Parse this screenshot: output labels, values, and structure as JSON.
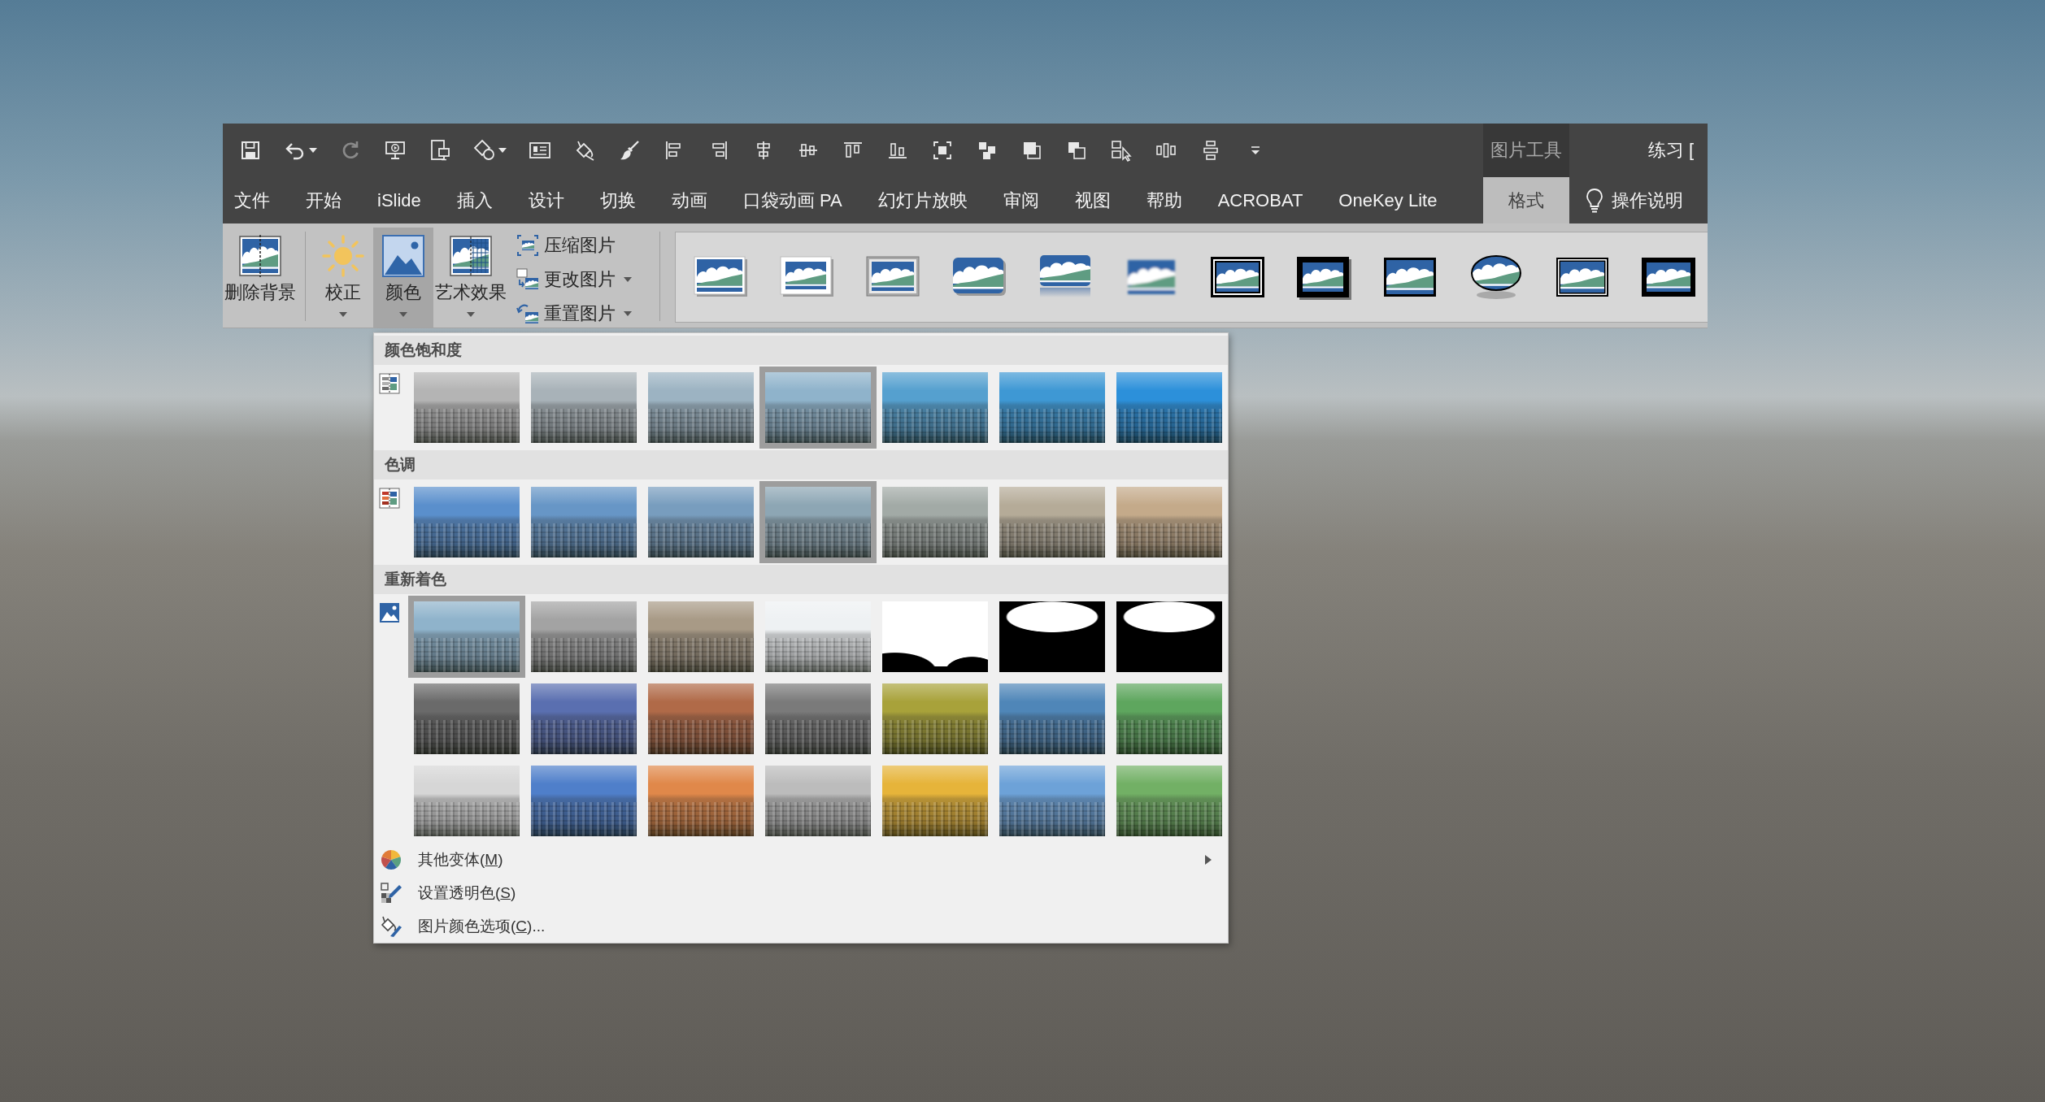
{
  "quick_access": [
    {
      "disabled": false
    },
    {
      "disabled": false
    },
    {
      "disabled": true
    },
    {
      "disabled": false
    },
    {
      "disabled": false
    },
    {
      "disabled": false
    },
    {
      "disabled": false
    },
    {
      "disabled": false
    },
    {
      "disabled": false
    },
    {
      "disabled": false
    },
    {
      "disabled": false
    },
    {
      "disabled": false
    },
    {
      "disabled": false
    },
    {
      "disabled": false
    },
    {
      "disabled": false
    },
    {
      "disabled": false
    },
    {
      "disabled": false
    },
    {
      "disabled": false
    },
    {
      "disabled": false
    },
    {
      "disabled": false
    },
    {
      "disabled": false
    },
    {
      "disabled": false
    },
    {
      "disabled": false
    }
  ],
  "window": {
    "title": "练习 ["
  },
  "tabs": [
    {
      "label": "文件",
      "selected": false
    },
    {
      "label": "开始",
      "selected": false
    },
    {
      "label": "iSlide",
      "selected": false
    },
    {
      "label": "插入",
      "selected": false
    },
    {
      "label": "设计",
      "selected": false
    },
    {
      "label": "切换",
      "selected": false
    },
    {
      "label": "动画",
      "selected": false
    },
    {
      "label": "口袋动画 PA",
      "selected": false
    },
    {
      "label": "幻灯片放映",
      "selected": false
    },
    {
      "label": "审阅",
      "selected": false
    },
    {
      "label": "视图",
      "selected": false
    },
    {
      "label": "帮助",
      "selected": false
    },
    {
      "label": "ACROBAT",
      "selected": false
    },
    {
      "label": "OneKey Lite",
      "selected": false
    }
  ],
  "context_group": {
    "title": "图片工具",
    "tabs": [
      {
        "label": "格式",
        "selected": true
      }
    ]
  },
  "tell_me": {
    "label": "操作说明"
  },
  "ribbon": {
    "groups": [
      {
        "large_buttons": [
          {
            "label": "删除背景",
            "dropdown": false,
            "pressed": false
          }
        ]
      },
      {
        "large_buttons": [
          {
            "label": "校正",
            "dropdown": true,
            "pressed": false
          },
          {
            "label": "颜色",
            "dropdown": true,
            "pressed": true
          },
          {
            "label": "艺术效果",
            "dropdown": true,
            "pressed": false
          }
        ],
        "small_buttons": [
          {
            "label": "压缩图片",
            "dropdown": false
          },
          {
            "label": "更改图片",
            "dropdown": true
          },
          {
            "label": "重置图片",
            "dropdown": true
          }
        ]
      }
    ]
  },
  "color_menu": {
    "sections": [
      {
        "title": "颜色饱和度",
        "presets": [
          {
            "kind": "photo",
            "color": "#b4b4b4",
            "selected": false
          },
          {
            "kind": "photo",
            "color": "#a8b2b8",
            "selected": false
          },
          {
            "kind": "photo",
            "color": "#9cb3c2",
            "selected": false
          },
          {
            "kind": "photo",
            "color": "#8fb3cb",
            "selected": true
          },
          {
            "kind": "photo",
            "color": "#55a0cf",
            "selected": false
          },
          {
            "kind": "photo",
            "color": "#3e98d4",
            "selected": false
          },
          {
            "kind": "photo",
            "color": "#2c90da",
            "selected": false
          }
        ]
      },
      {
        "title": "色调",
        "presets": [
          {
            "kind": "photo",
            "color": "#5a8fcc",
            "selected": false
          },
          {
            "kind": "photo",
            "color": "#6796c6",
            "selected": false
          },
          {
            "kind": "photo",
            "color": "#789dbe",
            "selected": false
          },
          {
            "kind": "photo",
            "color": "#8da6b4",
            "selected": true
          },
          {
            "kind": "photo",
            "color": "#a2aaa6",
            "selected": false
          },
          {
            "kind": "photo",
            "color": "#b5ab98",
            "selected": false
          },
          {
            "kind": "photo",
            "color": "#c4aa8a",
            "selected": false
          }
        ]
      },
      {
        "title": "重新着色",
        "presets": [
          {
            "kind": "photo",
            "color": "#8fb3cb",
            "selected": true
          },
          {
            "kind": "photo",
            "color": "#a3a3a3",
            "selected": false
          },
          {
            "kind": "photo",
            "color": "#a89a86",
            "selected": false
          },
          {
            "kind": "photo",
            "color": "#eef1f3",
            "selected": false
          },
          {
            "kind": "black_white",
            "color": "#ffffff",
            "selected": false
          },
          {
            "kind": "black_white",
            "color": "#000000",
            "selected": false
          },
          {
            "kind": "black_white",
            "color": "#000000",
            "selected": false
          },
          {
            "kind": "photo",
            "color": "#6a6a6a",
            "selected": false
          },
          {
            "kind": "photo",
            "color": "#5a6fb0",
            "selected": false
          },
          {
            "kind": "photo",
            "color": "#b06a48",
            "selected": false
          },
          {
            "kind": "photo",
            "color": "#7a7a7a",
            "selected": false
          },
          {
            "kind": "photo",
            "color": "#a8a23a",
            "selected": false
          },
          {
            "kind": "photo",
            "color": "#4f86b8",
            "selected": false
          },
          {
            "kind": "photo",
            "color": "#5ea65e",
            "selected": false
          },
          {
            "kind": "photo",
            "color": "#d6d6d6",
            "selected": false
          },
          {
            "kind": "photo",
            "color": "#4f7fca",
            "selected": false
          },
          {
            "kind": "photo",
            "color": "#e0884a",
            "selected": false
          },
          {
            "kind": "photo",
            "color": "#bcbcbc",
            "selected": false
          },
          {
            "kind": "photo",
            "color": "#e6b43a",
            "selected": false
          },
          {
            "kind": "photo",
            "color": "#6da2d8",
            "selected": false
          },
          {
            "kind": "photo",
            "color": "#72b065",
            "selected": false
          }
        ]
      }
    ],
    "commands": [
      {
        "text_before": "其他变体(",
        "shortcut": "M",
        "text_after": ")",
        "submenu": true
      },
      {
        "text_before": "设置透明色(",
        "shortcut": "S",
        "text_after": ")",
        "submenu": false
      },
      {
        "text_before": "图片颜色选项(",
        "shortcut": "C",
        "text_after": ")...",
        "submenu": false
      }
    ]
  }
}
